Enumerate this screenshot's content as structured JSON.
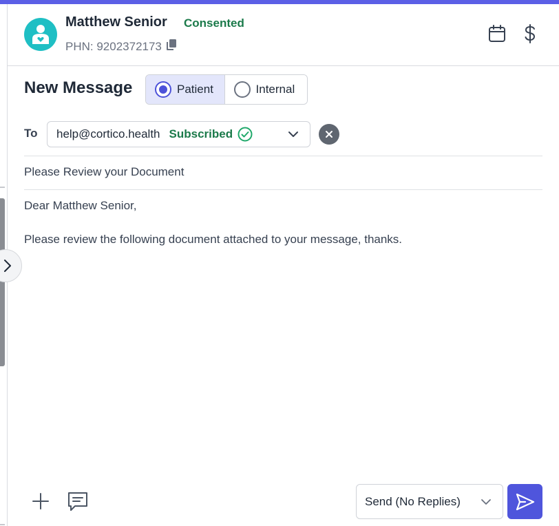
{
  "patient": {
    "name": "Matthew Senior",
    "consent_status": "Consented",
    "phn_label": "PHN: 9202372173"
  },
  "header_actions": {
    "calendar_icon": "calendar-icon",
    "billing_icon": "dollar-icon"
  },
  "compose": {
    "title": "New Message",
    "recipient_type_options": [
      "Patient",
      "Internal"
    ],
    "recipient_type_selected": "Patient",
    "to_label": "To",
    "to_email": "help@cortico.health",
    "to_status": "Subscribed",
    "subject": "Please Review your Document",
    "body_lines": [
      "Dear Matthew Senior,",
      "Please review the following document attached to your message, thanks."
    ]
  },
  "footer": {
    "send_mode": "Send (No Replies)"
  },
  "colors": {
    "accent": "#4f55dc",
    "status_green": "#1b7a4a",
    "avatar_teal": "#1fbfc4",
    "top_bar": "#5b5fe6"
  }
}
